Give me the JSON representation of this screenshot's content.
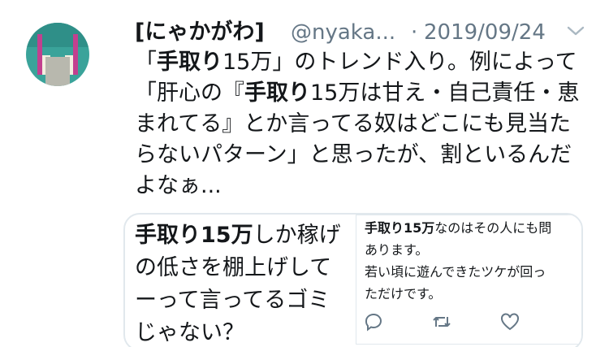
{
  "author": {
    "display_name": "[にゃかがわ]",
    "handle": "@nyaka...",
    "separator": "·",
    "date": "2019/09/24"
  },
  "tweet": {
    "lines": [
      {
        "pre": "「",
        "bold": "手取り",
        "post": "15万」のトレンド入り。例によって"
      },
      {
        "pre": "「肝心の『",
        "bold": "手取り",
        "post": "15万は甘え・自己責任・恵"
      },
      {
        "pre": "まれてる』とか言ってる奴はどこにも見当た",
        "bold": "",
        "post": ""
      },
      {
        "pre": "らないパターン」と思ったが、割といるんだ",
        "bold": "",
        "post": ""
      },
      {
        "pre": "よなぁ...",
        "bold": "",
        "post": ""
      }
    ]
  },
  "media": {
    "left_lines": [
      {
        "bold": "手取り15万",
        "post": "しか稼げ"
      },
      {
        "bold": "",
        "post": "の低さを棚上げして"
      },
      {
        "bold": "",
        "post": "ーって言ってるゴミ"
      },
      {
        "bold": "",
        "post": "じゃない？"
      }
    ],
    "right_lines": [
      {
        "bold": "手取り15万",
        "post": "なのはその人にも問"
      },
      {
        "bold": "",
        "post": "あります。"
      },
      {
        "bold": "",
        "post": "若い頃に遊んできたツケが回っ"
      },
      {
        "bold": "",
        "post": "ただけです。"
      }
    ],
    "icons": [
      "reply-icon",
      "retweet-icon",
      "like-icon"
    ]
  },
  "colors": {
    "secondary_text": "#657786",
    "border": "#e1e8ed",
    "avatar_bg": "#3aa39a"
  }
}
